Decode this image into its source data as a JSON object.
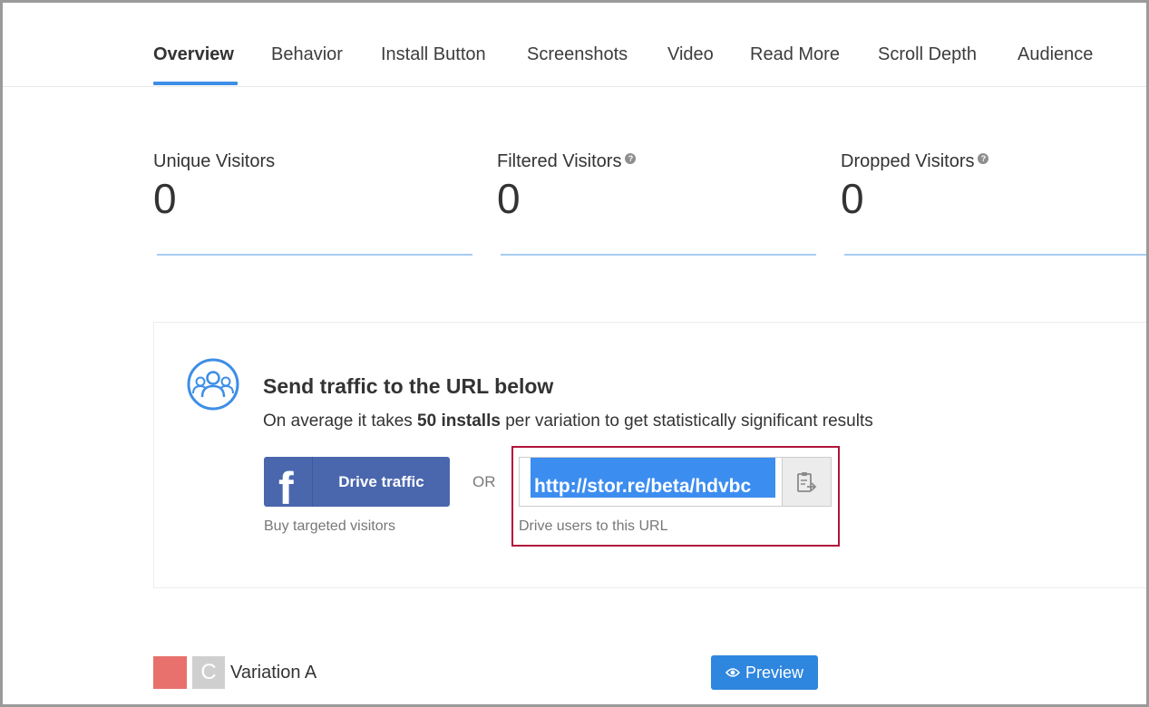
{
  "tabs": [
    {
      "label": "Overview",
      "active": true
    },
    {
      "label": "Behavior"
    },
    {
      "label": "Install Button"
    },
    {
      "label": "Screenshots"
    },
    {
      "label": "Video"
    },
    {
      "label": "Read More"
    },
    {
      "label": "Scroll Depth"
    },
    {
      "label": "Audience"
    }
  ],
  "stats": [
    {
      "label": "Unique Visitors",
      "value": "0"
    },
    {
      "label": "Filtered Visitors",
      "value": "0",
      "help_icon": "question-circle-icon"
    },
    {
      "label": "Dropped Visitors",
      "value": "0",
      "help_icon": "question-circle-icon"
    }
  ],
  "traffic": {
    "icon": "people-group-icon",
    "title": "Send traffic to the URL below",
    "subtitle_prefix": "On average it takes ",
    "subtitle_bold": "50 installs",
    "subtitle_suffix": " per variation to get statistically significant results",
    "facebook_button": {
      "icon": "facebook-icon",
      "icon_glyph": "f",
      "label": "Drive traffic"
    },
    "facebook_caption": "Buy targeted visitors",
    "or_text": "OR",
    "url_value": "http://stor.re/beta/hdvbc",
    "copy_icon": "clipboard-copy-icon",
    "url_caption": "Drive users to this URL"
  },
  "variation": {
    "color": "#e8716d",
    "letter": "C",
    "label": "Variation A",
    "preview_icon": "eye-icon",
    "preview_label": "Preview"
  },
  "colors": {
    "accent": "#3d8ee6",
    "facebook": "#4a67ad",
    "highlight_border": "#b2123b",
    "preview_button": "#2e86de"
  }
}
